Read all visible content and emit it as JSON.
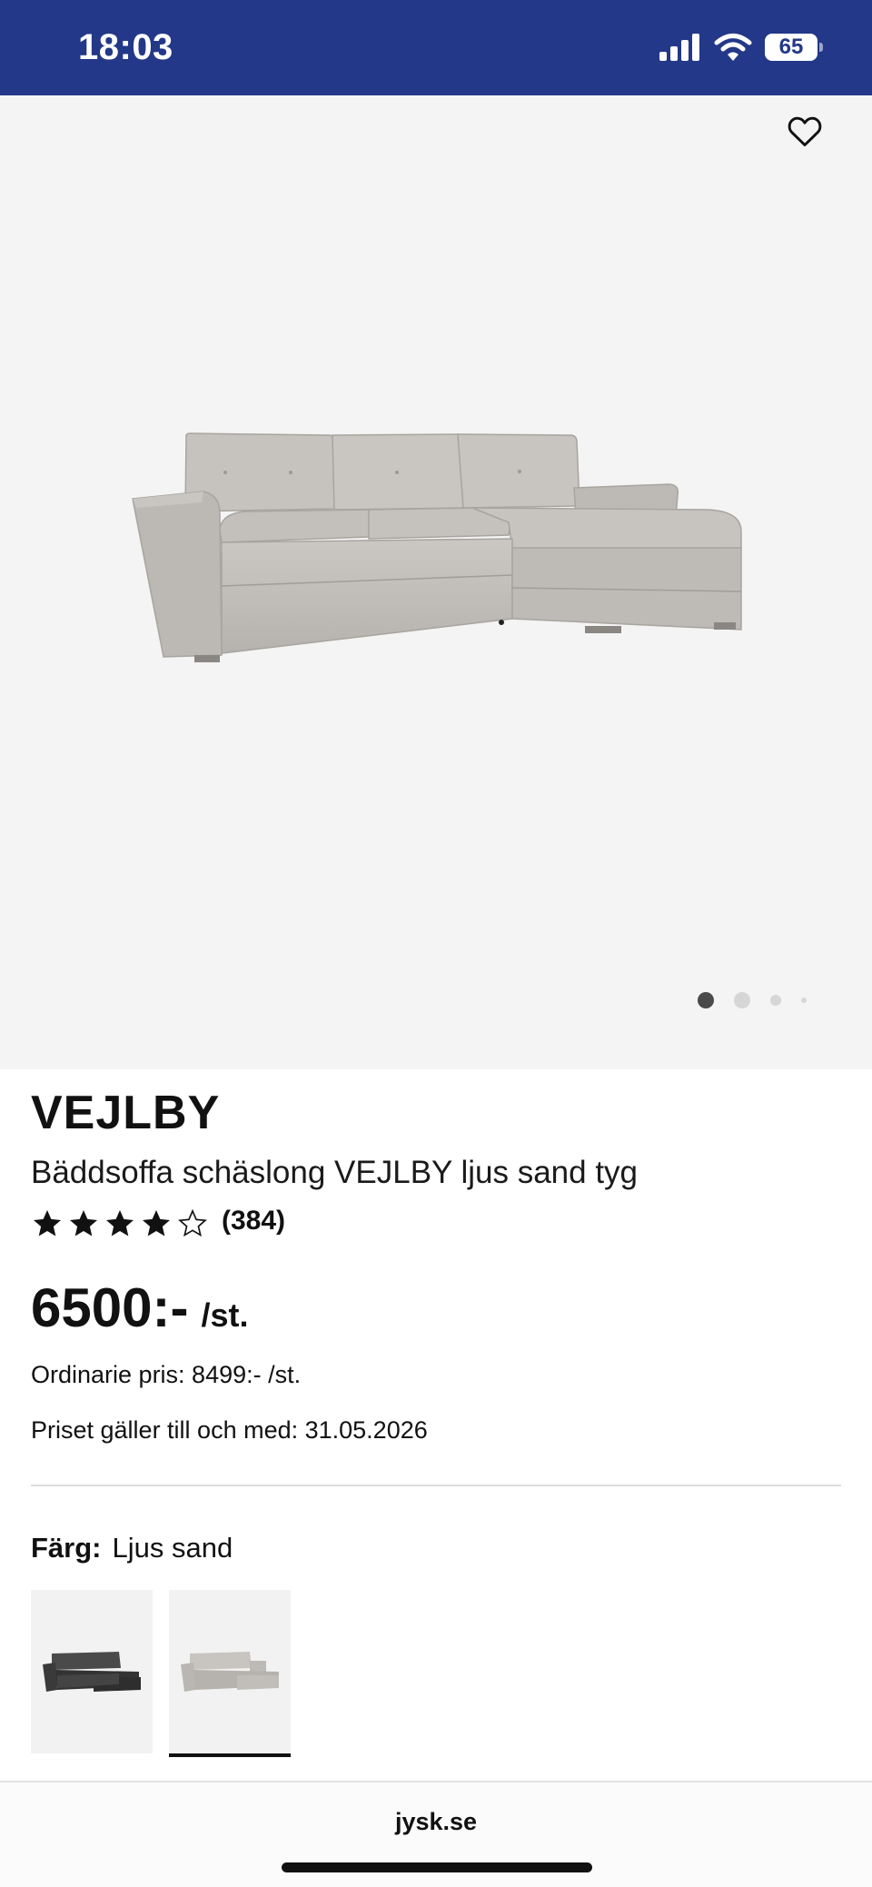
{
  "status_bar": {
    "time": "18:03",
    "battery": "65"
  },
  "gallery": {
    "dots": 4,
    "active_dot": 0
  },
  "product": {
    "brand": "VEJLBY",
    "subtitle": "Bäddsoffa schäslong VEJLBY ljus sand tyg",
    "rating": 4,
    "rating_max": 5,
    "review_count": "(384)",
    "price": "6500:-",
    "price_unit": "/st.",
    "ordinary_price": "Ordinarie pris: 8499:- /st.",
    "valid_until": "Priset gäller till och med: 31.05.2026"
  },
  "color": {
    "label": "Färg:",
    "value": "Ljus sand",
    "swatches": [
      {
        "name": "dark-grey",
        "selected": false,
        "fabric": "#3d3d3d"
      },
      {
        "name": "light-sand",
        "selected": true,
        "fabric": "#c4c0bb"
      }
    ]
  },
  "browser": {
    "url": "jysk.se"
  }
}
